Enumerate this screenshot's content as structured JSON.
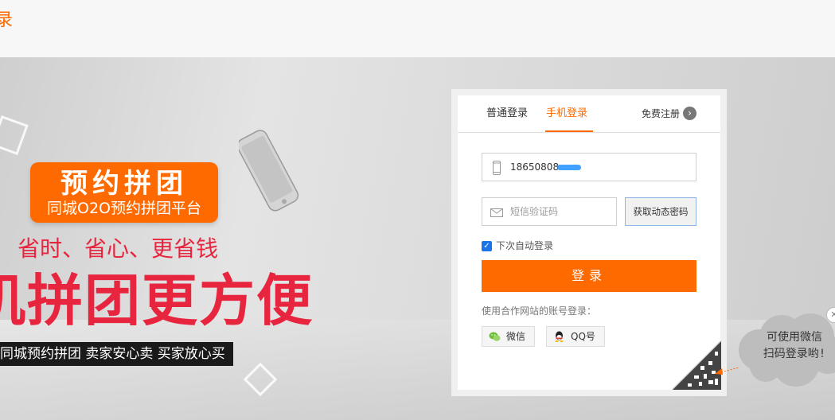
{
  "header": {
    "logo_text": "录"
  },
  "banner": {
    "badge_title": "预约拼团",
    "badge_subtitle": "同城O2O预约拼团平台",
    "slogan_1": "省时、省心、更省钱",
    "slogan_2": "机拼团更方便",
    "slogan_3": "同城预约拼团  卖家安心卖  买家放心买"
  },
  "login": {
    "tabs": [
      {
        "label": "普通登录",
        "active": false
      },
      {
        "label": "手机登录",
        "active": true
      }
    ],
    "register_label": "免费注册",
    "phone_value": "18650808",
    "code_placeholder": "短信验证码",
    "get_code_label": "获取动态密码",
    "remember_label": "下次自动登录",
    "remember_checked": true,
    "submit_label": "登录",
    "partner_label": "使用合作网站的账号登录：",
    "wechat_label": "微信",
    "qq_label": "QQ号"
  },
  "qr_tip": {
    "line1": "可使用微信",
    "line2": "扫码登录哟!"
  },
  "icons": {
    "phone": "phone-icon",
    "mail": "mail-icon",
    "arrow": "chevron-right-icon",
    "wechat": "wechat-icon",
    "qq": "qq-icon",
    "close": "close-icon"
  },
  "colors": {
    "accent": "#ff6a00",
    "slogan_red": "#e8253f",
    "checkbox_blue": "#1a73e8"
  }
}
